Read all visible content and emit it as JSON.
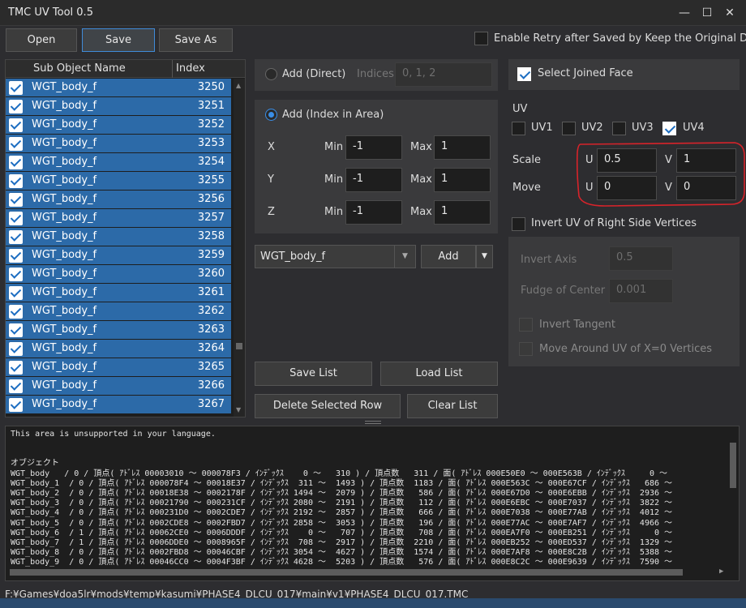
{
  "window": {
    "title": "TMC UV Tool 0.5",
    "min": "—",
    "max": "☐",
    "close": "✕"
  },
  "toolbar": {
    "open": "Open",
    "save": "Save",
    "save_as": "Save As",
    "retry_label": "Enable Retry after Saved by Keep the Original Data",
    "retry_checked": false
  },
  "table": {
    "col_name": "Sub Object Name",
    "col_index": "Index",
    "rows": [
      {
        "name": "WGT_body_f",
        "index": "3250"
      },
      {
        "name": "WGT_body_f",
        "index": "3251"
      },
      {
        "name": "WGT_body_f",
        "index": "3252"
      },
      {
        "name": "WGT_body_f",
        "index": "3253"
      },
      {
        "name": "WGT_body_f",
        "index": "3254"
      },
      {
        "name": "WGT_body_f",
        "index": "3255"
      },
      {
        "name": "WGT_body_f",
        "index": "3256"
      },
      {
        "name": "WGT_body_f",
        "index": "3257"
      },
      {
        "name": "WGT_body_f",
        "index": "3258"
      },
      {
        "name": "WGT_body_f",
        "index": "3259"
      },
      {
        "name": "WGT_body_f",
        "index": "3260"
      },
      {
        "name": "WGT_body_f",
        "index": "3261"
      },
      {
        "name": "WGT_body_f",
        "index": "3262"
      },
      {
        "name": "WGT_body_f",
        "index": "3263"
      },
      {
        "name": "WGT_body_f",
        "index": "3264"
      },
      {
        "name": "WGT_body_f",
        "index": "3265"
      },
      {
        "name": "WGT_body_f",
        "index": "3266"
      },
      {
        "name": "WGT_body_f",
        "index": "3267"
      }
    ]
  },
  "add_direct": {
    "label": "Add (Direct)",
    "indices_label": "Indices",
    "indices_placeholder": "0, 1, 2"
  },
  "add_area": {
    "label": "Add (Index in Area)",
    "min_label": "Min",
    "max_label": "Max",
    "x": {
      "label": "X",
      "min": "-1",
      "max": "1"
    },
    "y": {
      "label": "Y",
      "min": "-1",
      "max": "1"
    },
    "z": {
      "label": "Z",
      "min": "-1",
      "max": "1"
    }
  },
  "object_select": {
    "value": "WGT_body_f",
    "add": "Add"
  },
  "list_buttons": {
    "save": "Save List",
    "load": "Load List",
    "delete": "Delete Selected Row",
    "clear": "Clear List"
  },
  "right": {
    "select_joined": "Select Joined Face",
    "uv_header": "UV",
    "uv1": "UV1",
    "uv2": "UV2",
    "uv3": "UV3",
    "uv4": "UV4",
    "scale_label": "Scale",
    "move_label": "Move",
    "u": "U",
    "v": "V",
    "scale_u": "0.5",
    "scale_v": "1",
    "move_u": "0",
    "move_v": "0",
    "invert_right": "Invert UV of Right Side Vertices",
    "invert_axis_label": "Invert Axis",
    "invert_axis": "0.5",
    "fudge_label": "Fudge of Center",
    "fudge": "0.001",
    "invert_tangent": "Invert Tangent",
    "move_around": "Move Around UV of X=0 Vertices"
  },
  "log": {
    "lines": [
      "This area is unsupported in your language.",
      "",
      "オブジェクト",
      "WGT_body   / 0 / 頂点( ｱﾄﾞﾚｽ 00003010 ～ 000078F3 / ｲﾝﾃﾞｯｸｽ    0 ～   310 ) / 頂点数   311 / 面( ｱﾄﾞﾚｽ 000E50E0 ～ 000E563B / ｲﾝﾃﾞｯｸｽ     0 ～",
      "WGT_body_1  / 0 / 頂点( ｱﾄﾞﾚｽ 000078F4 ～ 00018E37 / ｲﾝﾃﾞｯｸｽ  311 ～  1493 ) / 頂点数  1183 / 面( ｱﾄﾞﾚｽ 000E563C ～ 000E67CF / ｲﾝﾃﾞｯｸｽ   686 ～",
      "WGT_body_2  / 0 / 頂点( ｱﾄﾞﾚｽ 00018E38 ～ 0002178F / ｲﾝﾃﾞｯｸｽ 1494 ～  2079 ) / 頂点数   586 / 面( ｱﾄﾞﾚｽ 000E67D0 ～ 000E6EBB / ｲﾝﾃﾞｯｸｽ  2936 ～",
      "WGT_body_3  / 0 / 頂点( ｱﾄﾞﾚｽ 00021790 ～ 000231CF / ｲﾝﾃﾞｯｸｽ 2080 ～  2191 ) / 頂点数   112 / 面( ｱﾄﾞﾚｽ 000E6EBC ～ 000E7037 / ｲﾝﾃﾞｯｸｽ  3822 ～",
      "WGT_body_4  / 0 / 頂点( ｱﾄﾞﾚｽ 000231D0 ～ 0002CDE7 / ｲﾝﾃﾞｯｸｽ 2192 ～  2857 ) / 頂点数   666 / 面( ｱﾄﾞﾚｽ 000E7038 ～ 000E77AB / ｲﾝﾃﾞｯｸｽ  4012 ～",
      "WGT_body_5  / 0 / 頂点( ｱﾄﾞﾚｽ 0002CDE8 ～ 0002FBD7 / ｲﾝﾃﾞｯｸｽ 2858 ～  3053 ) / 頂点数   196 / 面( ｱﾄﾞﾚｽ 000E77AC ～ 000E7AF7 / ｲﾝﾃﾞｯｸｽ  4966 ～",
      "WGT_body_6  / 1 / 頂点( ｱﾄﾞﾚｽ 00062CE0 ～ 0006DDDF / ｲﾝﾃﾞｯｸｽ    0 ～   707 ) / 頂点数   708 / 面( ｱﾄﾞﾚｽ 000EA7F0 ～ 000EB251 / ｲﾝﾃﾞｯｸｽ     0 ～",
      "WGT_body_7  / 1 / 頂点( ｱﾄﾞﾚｽ 0006DDE0 ～ 0008965F / ｲﾝﾃﾞｯｸｽ  708 ～  2917 ) / 頂点数  2210 / 面( ｱﾄﾞﾚｽ 000EB252 ～ 000ED537 / ｲﾝﾃﾞｯｸｽ  1329 ～",
      "WGT_body_8  / 0 / 頂点( ｱﾄﾞﾚｽ 0002FBD8 ～ 00046CBF / ｲﾝﾃﾞｯｸｽ 3054 ～  4627 ) / 頂点数  1574 / 面( ｱﾄﾞﾚｽ 000E7AF8 ～ 000E8C2B / ｲﾝﾃﾞｯｸｽ  5388 ～",
      "WGT_body_9  / 0 / 頂点( ｱﾄﾞﾚｽ 00046CC0 ～ 0004F3BF / ｲﾝﾃﾞｯｸｽ 4628 ～  5203 ) / 頂点数   576 / 面( ｱﾄﾞﾚｽ 000E8C2C ～ 000E9639 / ｲﾝﾃﾞｯｸｽ  7590 ～"
    ]
  },
  "status": {
    "path": "F:¥Games¥doa5lr¥mods¥temp¥kasumi¥PHASE4_DLCU_017¥main¥v1¥PHASE4_DLCU_017.TMC"
  },
  "colors": {
    "accent": "#2c6aa8",
    "highlight_border": "#d8232a",
    "focus": "#3f8bd8"
  }
}
